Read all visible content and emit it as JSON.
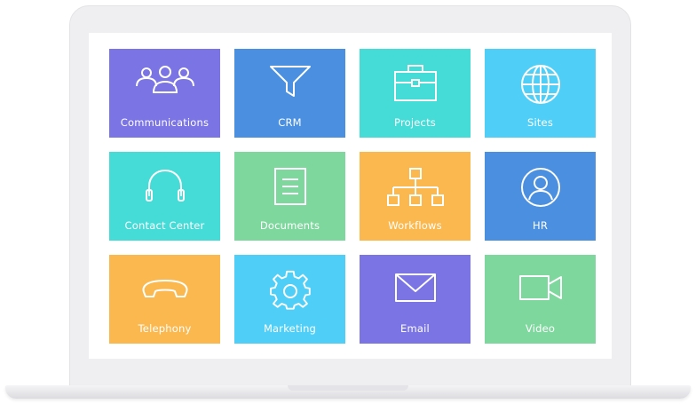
{
  "tiles": [
    {
      "label": "Communications",
      "icon": "people-group-icon",
      "color": "#7b74e4"
    },
    {
      "label": "CRM",
      "icon": "funnel-icon",
      "color": "#4a8fe0"
    },
    {
      "label": "Projects",
      "icon": "briefcase-icon",
      "color": "#45dcd8"
    },
    {
      "label": "Sites",
      "icon": "globe-icon",
      "color": "#4fcff7"
    },
    {
      "label": "Contact Center",
      "icon": "headphones-icon",
      "color": "#45dcd8"
    },
    {
      "label": "Documents",
      "icon": "document-icon",
      "color": "#7ed89d"
    },
    {
      "label": "Workflows",
      "icon": "org-chart-icon",
      "color": "#fbb84f"
    },
    {
      "label": "HR",
      "icon": "user-circle-icon",
      "color": "#4a8fe0"
    },
    {
      "label": "Telephony",
      "icon": "phone-handset-icon",
      "color": "#fbb84f"
    },
    {
      "label": "Marketing",
      "icon": "gear-icon",
      "color": "#4fcff7"
    },
    {
      "label": "Email",
      "icon": "envelope-icon",
      "color": "#7b74e4"
    },
    {
      "label": "Video",
      "icon": "video-camera-icon",
      "color": "#7ed89d"
    }
  ]
}
